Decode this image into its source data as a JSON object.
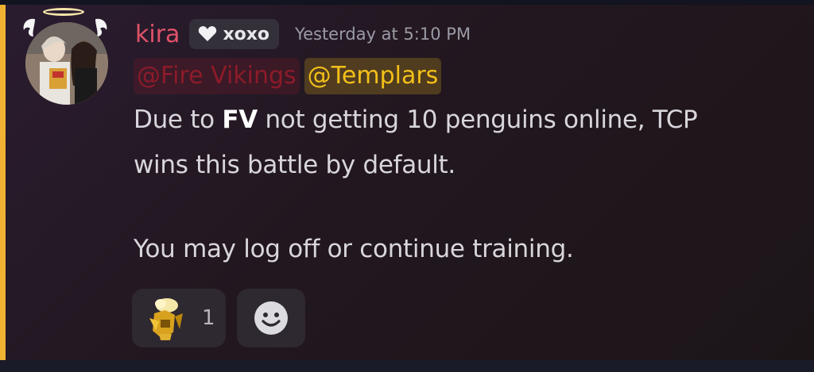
{
  "message": {
    "author": "kira",
    "tag": {
      "icon": "heart-icon",
      "text": "xoxo"
    },
    "timestamp": "Yesterday at 5:10 PM",
    "mentions": [
      "@Fire Vikings",
      "@Templars"
    ],
    "line1_prefix": "Due to ",
    "line1_bold": "FV",
    "line1_suffix": " not getting 10 penguins online, TCP",
    "line2": "wins this battle by default.",
    "line3": "You may log off or continue training."
  },
  "reactions": [
    {
      "emoji": "knight-emoji",
      "count": "1"
    }
  ],
  "add_reaction_icon": "smiley-icon",
  "colors": {
    "username": "#e0526a",
    "fire_vikings_role": "#8c1b2a",
    "templars_role": "#f3c019",
    "mention_stripe": "#f0b232"
  }
}
